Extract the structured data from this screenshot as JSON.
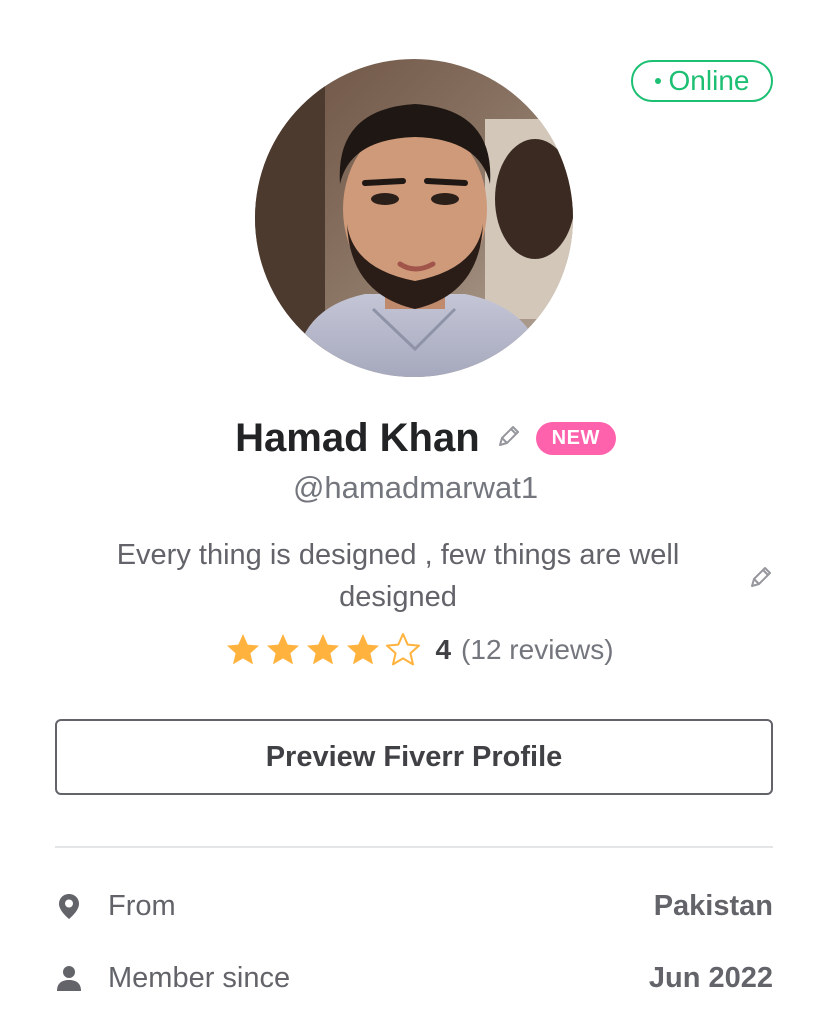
{
  "status": {
    "label": "Online",
    "color": "#1dbf73"
  },
  "profile": {
    "name": "Hamad Khan",
    "badge": "NEW",
    "username": "@hamadmarwat1",
    "tagline": "Every thing is designed , few things are well designed",
    "avatar_icon": "profile-photo"
  },
  "rating": {
    "stars_filled": 4,
    "stars_total": 5,
    "value": "4",
    "reviews": "(12 reviews)",
    "star_color": "#ffb33e"
  },
  "actions": {
    "preview_label": "Preview Fiverr Profile"
  },
  "info": {
    "from_label": "From",
    "from_value": "Pakistan",
    "member_label": "Member since",
    "member_value": "Jun 2022"
  },
  "colors": {
    "accent": "#1dbf73",
    "badge": "#ff62ad",
    "text": "#404145"
  }
}
